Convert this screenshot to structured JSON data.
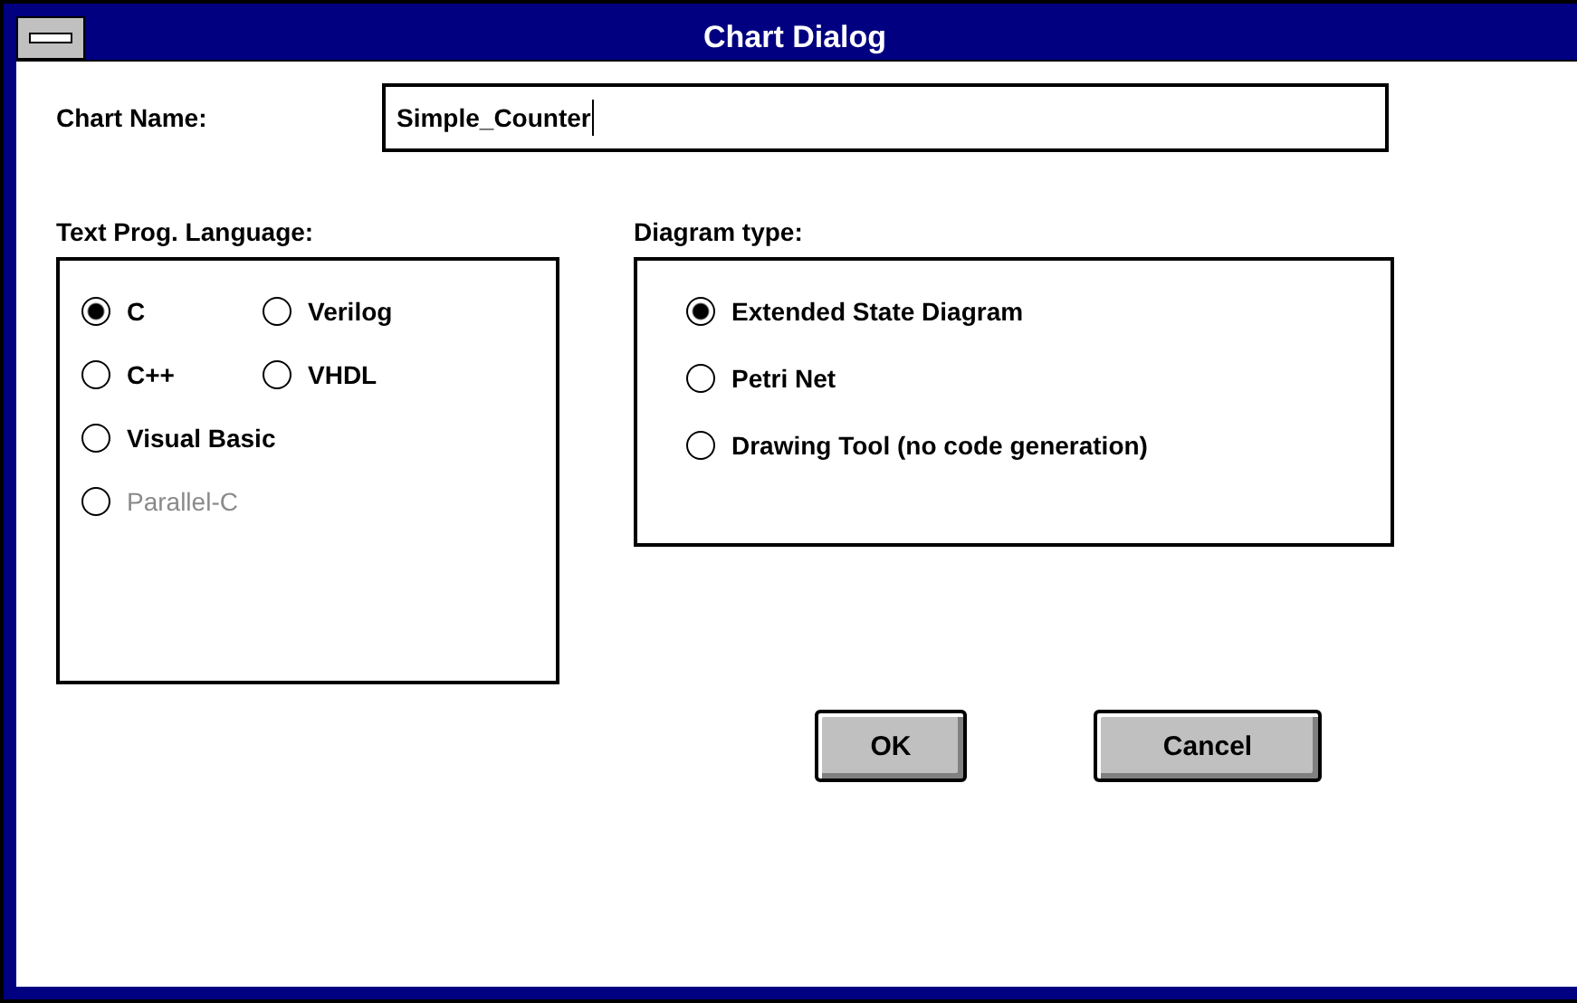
{
  "window": {
    "title": "Chart Dialog"
  },
  "chart_name": {
    "label": "Chart Name:",
    "value": "Simple_Counter"
  },
  "language": {
    "label": "Text Prog. Language:",
    "options": [
      {
        "label": "C",
        "selected": true,
        "disabled": false
      },
      {
        "label": "Verilog",
        "selected": false,
        "disabled": false
      },
      {
        "label": "C++",
        "selected": false,
        "disabled": false
      },
      {
        "label": "VHDL",
        "selected": false,
        "disabled": false
      },
      {
        "label": "Visual Basic",
        "selected": false,
        "disabled": false
      },
      {
        "label": "Parallel-C",
        "selected": false,
        "disabled": true
      }
    ]
  },
  "diagram_type": {
    "label": "Diagram type:",
    "options": [
      {
        "label": "Extended State Diagram",
        "selected": true
      },
      {
        "label": "Petri Net",
        "selected": false
      },
      {
        "label": "Drawing Tool (no code generation)",
        "selected": false
      }
    ]
  },
  "buttons": [
    {
      "label": "OK"
    },
    {
      "label": "Cancel"
    }
  ]
}
